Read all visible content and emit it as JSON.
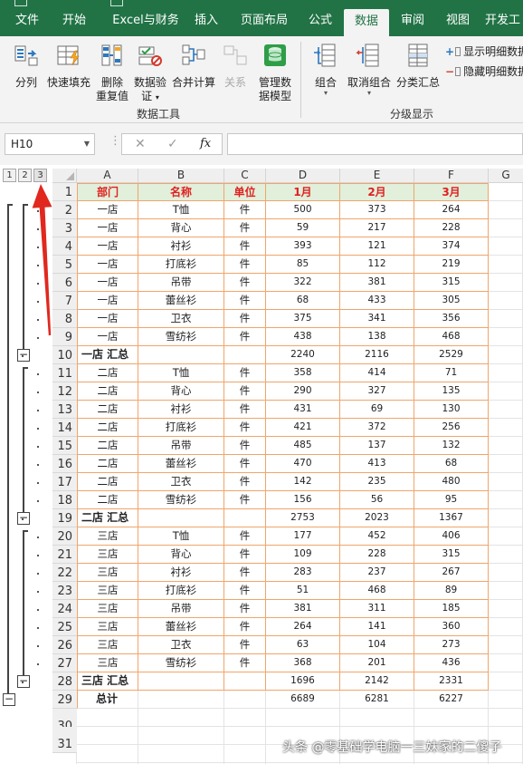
{
  "ribbon_tabs": [
    "文件",
    "开始",
    "Excel与财务",
    "插入",
    "页面布局",
    "公式",
    "数据",
    "审阅",
    "视图",
    "开发工"
  ],
  "active_tab": "数据",
  "ribbon": {
    "data_tools": {
      "buttons": [
        {
          "label": "分列",
          "icon": "text-to-columns-icon"
        },
        {
          "label": "快速填充",
          "icon": "flash-fill-icon"
        },
        {
          "label": "删除重复值",
          "label_lines": [
            "删除",
            "重复值"
          ],
          "icon": "remove-duplicates-icon"
        },
        {
          "label": "数据验证",
          "label_lines": [
            "数据验",
            "证"
          ],
          "icon": "data-validation-icon",
          "has_dropdown": true
        },
        {
          "label": "合并计算",
          "icon": "consolidate-icon"
        },
        {
          "label": "关系",
          "icon": "relationships-icon",
          "disabled": true
        },
        {
          "label": "管理数据模型",
          "label_lines": [
            "管理数",
            "据模型"
          ],
          "icon": "data-model-icon"
        }
      ],
      "group_label": "数据工具"
    },
    "outline": {
      "buttons": [
        {
          "label": "组合",
          "icon": "group-icon",
          "has_dropdown": true
        },
        {
          "label": "取消组合",
          "icon": "ungroup-icon",
          "has_dropdown": true
        },
        {
          "label": "分类汇总",
          "icon": "subtotal-icon"
        }
      ],
      "show_detail": "显示明细数据",
      "hide_detail": "隐藏明细数据",
      "group_label": "分级显示"
    }
  },
  "formula_bar": {
    "name_box": "H10",
    "cancel_symbol": "✕",
    "enter_symbol": "✓",
    "fx_label": "fx",
    "value": ""
  },
  "outline_levels": [
    "1",
    "2",
    "3"
  ],
  "columns": [
    "A",
    "B",
    "C",
    "D",
    "E",
    "F",
    "G"
  ],
  "header_row": {
    "row": "1",
    "cells": [
      "部门",
      "名称",
      "单位",
      "1月",
      "2月",
      "3月"
    ]
  },
  "rows": [
    {
      "row": "2",
      "type": "data",
      "cells": [
        "一店",
        "T恤",
        "件",
        "500",
        "373",
        "264"
      ]
    },
    {
      "row": "3",
      "type": "data",
      "cells": [
        "一店",
        "背心",
        "件",
        "59",
        "217",
        "228"
      ]
    },
    {
      "row": "4",
      "type": "data",
      "cells": [
        "一店",
        "衬衫",
        "件",
        "393",
        "121",
        "374"
      ]
    },
    {
      "row": "5",
      "type": "data",
      "cells": [
        "一店",
        "打底衫",
        "件",
        "85",
        "112",
        "219"
      ]
    },
    {
      "row": "6",
      "type": "data",
      "cells": [
        "一店",
        "吊带",
        "件",
        "322",
        "381",
        "315"
      ]
    },
    {
      "row": "7",
      "type": "data",
      "cells": [
        "一店",
        "蕾丝衫",
        "件",
        "68",
        "433",
        "305"
      ]
    },
    {
      "row": "8",
      "type": "data",
      "cells": [
        "一店",
        "卫衣",
        "件",
        "375",
        "341",
        "356"
      ]
    },
    {
      "row": "9",
      "type": "data",
      "cells": [
        "一店",
        "雪纺衫",
        "件",
        "438",
        "138",
        "468"
      ]
    },
    {
      "row": "10",
      "type": "subtotal",
      "cells": [
        "一店 汇总",
        "",
        "",
        "2240",
        "2116",
        "2529"
      ]
    },
    {
      "row": "11",
      "type": "data",
      "cells": [
        "二店",
        "T恤",
        "件",
        "358",
        "414",
        "71"
      ]
    },
    {
      "row": "12",
      "type": "data",
      "cells": [
        "二店",
        "背心",
        "件",
        "290",
        "327",
        "135"
      ]
    },
    {
      "row": "13",
      "type": "data",
      "cells": [
        "二店",
        "衬衫",
        "件",
        "431",
        "69",
        "130"
      ]
    },
    {
      "row": "14",
      "type": "data",
      "cells": [
        "二店",
        "打底衫",
        "件",
        "421",
        "372",
        "256"
      ]
    },
    {
      "row": "15",
      "type": "data",
      "cells": [
        "二店",
        "吊带",
        "件",
        "485",
        "137",
        "132"
      ]
    },
    {
      "row": "16",
      "type": "data",
      "cells": [
        "二店",
        "蕾丝衫",
        "件",
        "470",
        "413",
        "68"
      ]
    },
    {
      "row": "17",
      "type": "data",
      "cells": [
        "二店",
        "卫衣",
        "件",
        "142",
        "235",
        "480"
      ]
    },
    {
      "row": "18",
      "type": "data",
      "cells": [
        "二店",
        "雪纺衫",
        "件",
        "156",
        "56",
        "95"
      ]
    },
    {
      "row": "19",
      "type": "subtotal",
      "cells": [
        "二店 汇总",
        "",
        "",
        "2753",
        "2023",
        "1367"
      ]
    },
    {
      "row": "20",
      "type": "data",
      "cells": [
        "三店",
        "T恤",
        "件",
        "177",
        "452",
        "406"
      ]
    },
    {
      "row": "21",
      "type": "data",
      "cells": [
        "三店",
        "背心",
        "件",
        "109",
        "228",
        "315"
      ]
    },
    {
      "row": "22",
      "type": "data",
      "cells": [
        "三店",
        "衬衫",
        "件",
        "283",
        "237",
        "267"
      ]
    },
    {
      "row": "23",
      "type": "data",
      "cells": [
        "三店",
        "打底衫",
        "件",
        "51",
        "468",
        "89"
      ]
    },
    {
      "row": "24",
      "type": "data",
      "cells": [
        "三店",
        "吊带",
        "件",
        "381",
        "311",
        "185"
      ]
    },
    {
      "row": "25",
      "type": "data",
      "cells": [
        "三店",
        "蕾丝衫",
        "件",
        "264",
        "141",
        "360"
      ]
    },
    {
      "row": "26",
      "type": "data",
      "cells": [
        "三店",
        "卫衣",
        "件",
        "63",
        "104",
        "273"
      ]
    },
    {
      "row": "27",
      "type": "data",
      "cells": [
        "三店",
        "雪纺衫",
        "件",
        "368",
        "201",
        "436"
      ]
    },
    {
      "row": "28",
      "type": "subtotal",
      "cells": [
        "三店 汇总",
        "",
        "",
        "1696",
        "2142",
        "2331"
      ]
    },
    {
      "row": "29",
      "type": "total",
      "cells": [
        "总计",
        "",
        "",
        "6689",
        "6281",
        "6227"
      ]
    },
    {
      "row": "30",
      "type": "empty",
      "cells": []
    },
    {
      "row": "31",
      "type": "empty",
      "cells": []
    }
  ],
  "annotation": {
    "arrow_color": "#e0281e",
    "points_to": "3"
  },
  "watermark": "头条 @零基础学电脑一三妹家的二傻子",
  "colors": {
    "ribbon": "#217346",
    "header_fill": "#e2efda",
    "header_text": "#e02020",
    "cell_border": "#f0a56b"
  }
}
